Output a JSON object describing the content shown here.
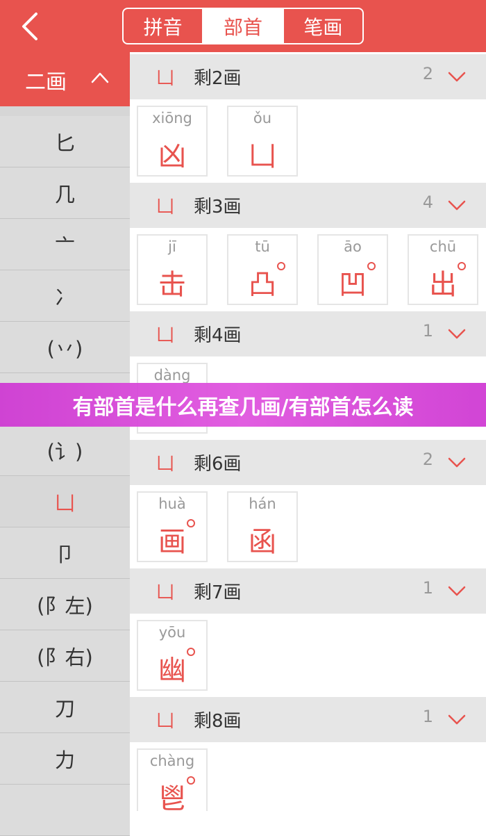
{
  "header": {
    "back_icon": "chevron-left-icon",
    "tabs": [
      {
        "label": "拼音",
        "active": false
      },
      {
        "label": "部首",
        "active": true
      },
      {
        "label": "笔画",
        "active": false
      }
    ],
    "accent_color": "#e8534e"
  },
  "sidebar": {
    "header_label": "二画",
    "header_icon": "chevron-up-icon",
    "items": [
      "匕",
      "几",
      "亠",
      "冫",
      "(丷)",
      "",
      "(讠)",
      "凵",
      "卩",
      "(阝左)",
      "(阝右)",
      "刀",
      "力",
      ""
    ],
    "active_item": "凵"
  },
  "groups": [
    {
      "radical": "凵",
      "label": "剩2画",
      "count": "2",
      "chars": [
        {
          "pinyin": "xiōng",
          "char": "凶",
          "dot": false
        },
        {
          "pinyin": "ǒu",
          "char": "凵",
          "dot": false
        }
      ]
    },
    {
      "radical": "凵",
      "label": "剩3画",
      "count": "4",
      "chars": [
        {
          "pinyin": "jī",
          "char": "击",
          "dot": false
        },
        {
          "pinyin": "tū",
          "char": "凸",
          "dot": true
        },
        {
          "pinyin": "āo",
          "char": "凹",
          "dot": true
        },
        {
          "pinyin": "chū",
          "char": "出",
          "dot": true
        }
      ]
    },
    {
      "radical": "凵",
      "label": "剩4画",
      "count": "1",
      "chars": [
        {
          "pinyin": "dàng",
          "char": "",
          "dot": false
        }
      ]
    },
    {
      "radical": "凵",
      "label": "剩6画",
      "count": "2",
      "chars": [
        {
          "pinyin": "huà",
          "char": "画",
          "dot": true
        },
        {
          "pinyin": "hán",
          "char": "函",
          "dot": false
        }
      ]
    },
    {
      "radical": "凵",
      "label": "剩7画",
      "count": "1",
      "chars": [
        {
          "pinyin": "yōu",
          "char": "幽",
          "dot": true
        }
      ]
    },
    {
      "radical": "凵",
      "label": "剩8画",
      "count": "1",
      "chars": [
        {
          "pinyin": "chàng",
          "char": "鬯",
          "dot": true
        }
      ]
    }
  ],
  "banner": {
    "text": "有部首是什么再查几画/有部首怎么读"
  }
}
